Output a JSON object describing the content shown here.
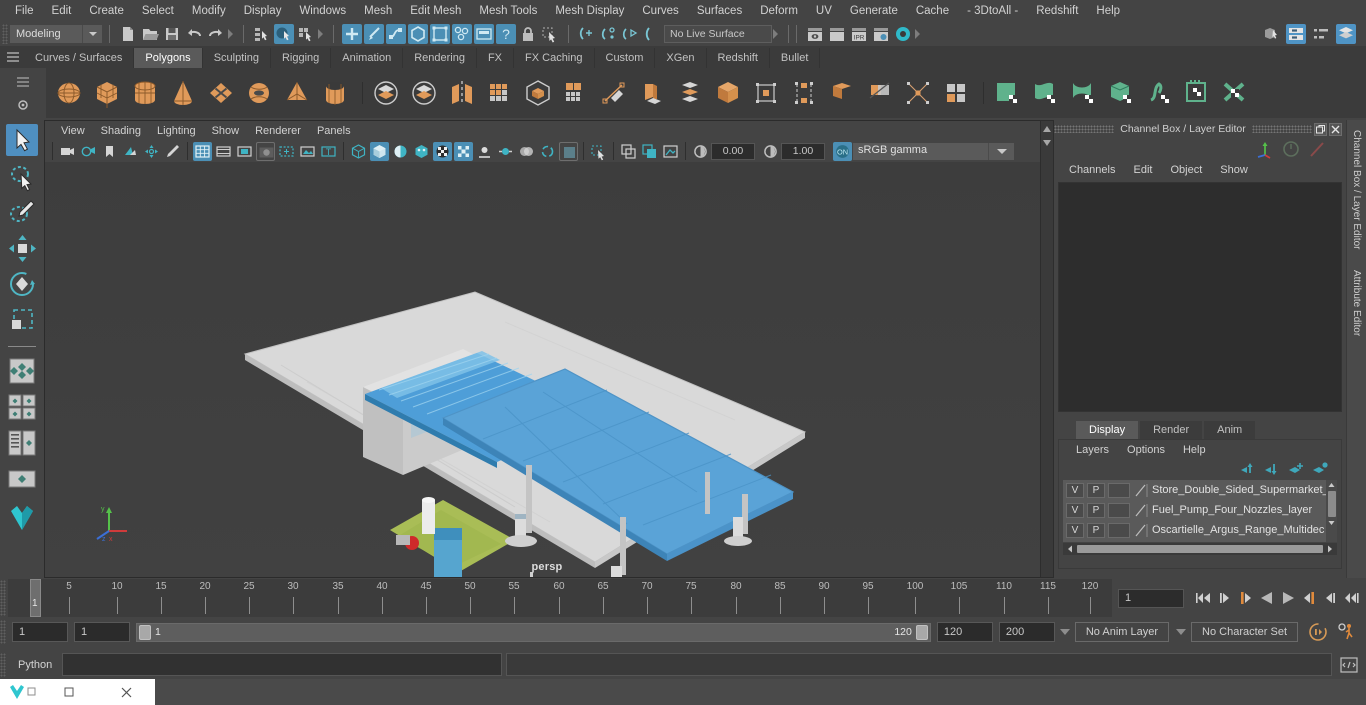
{
  "app": {
    "name": "Autodesk Maya",
    "accent": "#4f94c5",
    "bg": "#444444"
  },
  "menubar": {
    "items": [
      "File",
      "Edit",
      "Create",
      "Select",
      "Modify",
      "Display",
      "Windows",
      "Mesh",
      "Edit Mesh",
      "Mesh Tools",
      "Mesh Display",
      "Curves",
      "Surfaces",
      "Deform",
      "UV",
      "Generate",
      "Cache",
      "- 3DtoAll -",
      "Redshift",
      "Help"
    ]
  },
  "statusline": {
    "menuset": "Modeling",
    "live_surface": "No Live Surface",
    "icons": [
      "new-scene-icon",
      "open-scene-icon",
      "save-scene-icon",
      "undo-icon",
      "redo-icon",
      "select-by-hierarchy-icon",
      "select-by-object-icon",
      "select-by-component-icon",
      "snap-grid-icon",
      "snap-curve-icon",
      "snap-point-icon",
      "snap-projected-icon",
      "snap-view-plane-icon",
      "make-live-icon",
      "construction-history-icon",
      "help-icon",
      "lock-icon",
      "select-tool-icon",
      "render-current-frame-icon",
      "ipr-render-icon",
      "render-settings-icon",
      "hypershade-icon",
      "show-hide-modeling-toolkit-icon",
      "show-hide-attribute-editor-icon",
      "show-hide-tool-settings-icon",
      "show-hide-channel-box-icon"
    ]
  },
  "shelf": {
    "tabs": [
      "Curves / Surfaces",
      "Polygons",
      "Sculpting",
      "Rigging",
      "Animation",
      "Rendering",
      "FX",
      "FX Caching",
      "Custom",
      "XGen",
      "Redshift",
      "Bullet"
    ],
    "active_tab": "Polygons",
    "icons": [
      "polygon-sphere-icon",
      "polygon-cube-icon",
      "polygon-cylinder-icon",
      "polygon-cone-icon",
      "polygon-plane-icon",
      "polygon-torus-icon",
      "polygon-pyramid-icon",
      "polygon-pipe-icon",
      "combine-icon",
      "booleans-icon",
      "mirror-icon",
      "smooth-icon",
      "extract-icon",
      "quad-draw-icon",
      "multi-cut-icon",
      "target-weld-icon",
      "extrude-icon",
      "bevel-icon",
      "bridge-icon",
      "wedge-icon",
      "sculpt-icon",
      "duplicate-face-icon",
      "sculpt-tool-icon",
      "smooth-target-icon",
      "relax-tool-icon",
      "grab-tool-icon",
      "pinch-tool-icon",
      "freeze-tool-icon",
      "flood-tool-icon"
    ]
  },
  "toolbox": {
    "tools": [
      {
        "name": "select-tool",
        "active": true
      },
      {
        "name": "lasso-select-tool",
        "active": false
      },
      {
        "name": "paint-select-tool",
        "active": false
      },
      {
        "name": "move-tool",
        "active": false
      },
      {
        "name": "rotate-tool",
        "active": false
      },
      {
        "name": "scale-tool",
        "active": false
      },
      {
        "name": "last-tool-used",
        "active": false
      },
      {
        "name": "four-view-layout",
        "active": false
      },
      {
        "name": "persp-outliner-layout",
        "active": false
      },
      {
        "name": "persp-graph-layout",
        "active": false
      },
      {
        "name": "single-perspective-layout",
        "active": false
      }
    ]
  },
  "viewport": {
    "menus": [
      "View",
      "Shading",
      "Lighting",
      "Show",
      "Renderer",
      "Panels"
    ],
    "toolbar_icons": [
      "camera-select-icon",
      "camera-attributes-icon",
      "bookmark-icon",
      "image-plane-icon",
      "two-d-pan-zoom-icon",
      "grease-pencil-icon",
      "grid-toggle-icon",
      "film-gate-icon",
      "resolution-gate-icon",
      "gate-mask-icon",
      "film-origin-icon",
      "exposure-icon",
      "xray-joints-icon",
      "wireframe-icon",
      "smooth-shade-icon",
      "shaded-wireframe-icon",
      "hardware-texture-icon",
      "use-default-lighting-icon",
      "toggle-shadows-icon",
      "screen-space-ao-icon",
      "motion-blur-icon",
      "multisample-icon",
      "depth-of-field-icon",
      "isolate-select-icon",
      "xray-mode-icon",
      "xray-active-components-icon",
      "xray-shaded-icon",
      "exposure-icon-2",
      "gamma-icon"
    ],
    "exposure_value": "0.00",
    "gamma_value": "1.00",
    "color_management": "sRGB gamma",
    "camera_label": "persp",
    "axis_labels": {
      "x": "x",
      "y": "y",
      "z": "z"
    },
    "scene": {
      "description": "3D model of a gas station / supermarket with blue canopy roof",
      "roof_color": "#5a9fd4",
      "ground_color": "#d3d3d3",
      "grass_color": "#a6bd52"
    }
  },
  "right_panel": {
    "title": "Channel Box / Layer Editor",
    "menus": [
      "Channels",
      "Edit",
      "Object",
      "Show"
    ],
    "window_buttons": [
      "restore-icon",
      "close-icon"
    ],
    "gizmo_icons": [
      "axis-gizmo-icon",
      "clock-gizmo-icon",
      "slash-gizmo-icon"
    ],
    "layer_editor": {
      "tabs": [
        "Display",
        "Render",
        "Anim"
      ],
      "active_tab": "Display",
      "menus": [
        "Layers",
        "Options",
        "Help"
      ],
      "buttons": [
        "move-layer-up-icon",
        "move-layer-down-icon",
        "new-layer-icon",
        "new-layer-from-selected-icon"
      ],
      "columns": [
        "V",
        "P",
        ""
      ],
      "layers": [
        {
          "visible": "V",
          "playback": "P",
          "state": "",
          "name": "Store_Double_Sided_Supermarket_"
        },
        {
          "visible": "V",
          "playback": "P",
          "state": "",
          "name": "Fuel_Pump_Four_Nozzles_layer"
        },
        {
          "visible": "V",
          "playback": "P",
          "state": "",
          "name": "Oscartielle_Argus_Range_Multidec"
        }
      ]
    },
    "side_tabs": [
      "Channel Box / Layer Editor",
      "Attribute Editor"
    ]
  },
  "time_slider": {
    "tick_labels": [
      "5",
      "10",
      "15",
      "20",
      "25",
      "30",
      "35",
      "40",
      "45",
      "50",
      "55",
      "60",
      "65",
      "70",
      "75",
      "80",
      "85",
      "90",
      "95",
      "100",
      "105",
      "110",
      "115",
      "120"
    ],
    "current_frame_marker": "1",
    "current_frame_field": "1",
    "playback_buttons": [
      "go-to-start-icon",
      "step-back-keyframe-icon",
      "step-back-frame-icon",
      "play-backwards-icon",
      "play-forwards-icon",
      "step-forward-frame-icon",
      "step-forward-keyframe-icon",
      "go-to-end-icon"
    ]
  },
  "range_slider": {
    "anim_start": "1",
    "range_start": "1",
    "range_bar_start": "1",
    "range_bar_end": "120",
    "range_end": "120",
    "anim_end": "200",
    "anim_layer": "No Anim Layer",
    "character_set": "No Character Set",
    "icons": [
      "auto-keyframe-icon",
      "animation-preferences-icon"
    ]
  },
  "command_line": {
    "language": "Python",
    "input_value": "",
    "output_value": "",
    "icon": "script-editor-icon"
  },
  "taskbar": {
    "window_icon": "maya-app-icon",
    "buttons": [
      "maximize-button",
      "close-button"
    ]
  }
}
